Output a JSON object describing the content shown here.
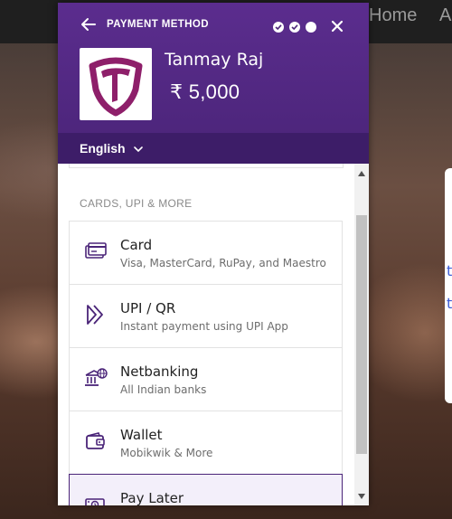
{
  "background": {
    "nav_items": [
      "Home",
      "A"
    ],
    "side_card_letters": [
      "t",
      "t"
    ]
  },
  "modal": {
    "title": "PAYMENT METHOD",
    "steps": [
      "done",
      "done",
      "current"
    ],
    "merchant_name": "Tanmay Raj",
    "amount": "₹ 5,000",
    "language": "English",
    "section_label": "CARDS, UPI & MORE",
    "methods": [
      {
        "title": "Card",
        "subtitle": "Visa, MasterCard, RuPay, and Maestro",
        "icon": "card-icon"
      },
      {
        "title": "UPI / QR",
        "subtitle": "Instant payment using UPI App",
        "icon": "upi-icon"
      },
      {
        "title": "Netbanking",
        "subtitle": "All Indian banks",
        "icon": "bank-icon"
      },
      {
        "title": "Wallet",
        "subtitle": "Mobikwik & More",
        "icon": "wallet-icon"
      },
      {
        "title": "Pay Later",
        "subtitle": "",
        "icon": "pay-later-icon"
      }
    ],
    "colors": {
      "header": "#5b2d8e",
      "language_bar": "#3d1d68",
      "accent": "#4a2478",
      "logo_accent": "#8e1f6a"
    }
  }
}
